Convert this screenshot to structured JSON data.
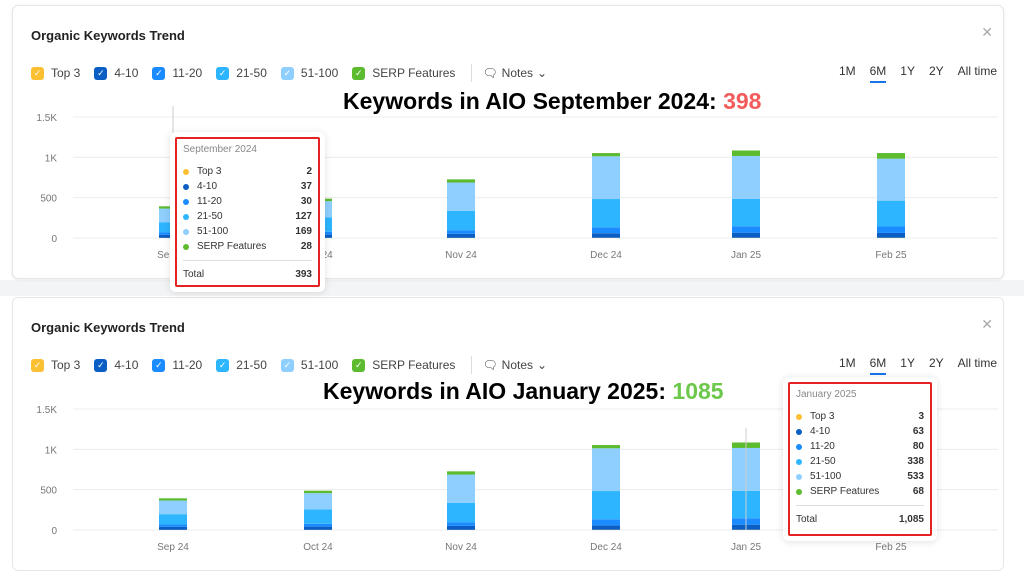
{
  "panel_title": "Organic Keywords Trend",
  "legend": [
    {
      "label": "Top 3",
      "color": "#fbbf32"
    },
    {
      "label": "4-10",
      "color": "#0b5fc4"
    },
    {
      "label": "11-20",
      "color": "#1a8cff"
    },
    {
      "label": "21-50",
      "color": "#2db5ff"
    },
    {
      "label": "51-100",
      "color": "#8fcfff"
    },
    {
      "label": "SERP Features",
      "color": "#5dbb2f"
    }
  ],
  "notes_label": "Notes",
  "ranges": [
    "1M",
    "6M",
    "1Y",
    "2Y",
    "All time"
  ],
  "active_range": "6M",
  "headline_top": {
    "text": "Keywords in AIO September 2024: ",
    "value": "398",
    "color": "#f25c5c"
  },
  "headline_bottom": {
    "text": "Keywords in AIO January 2025: ",
    "value": "1085",
    "color": "#6cc84a"
  },
  "tooltip_top": {
    "title": "September 2024",
    "rows": [
      {
        "label": "Top 3",
        "value": "2"
      },
      {
        "label": "4-10",
        "value": "37"
      },
      {
        "label": "11-20",
        "value": "30"
      },
      {
        "label": "21-50",
        "value": "127"
      },
      {
        "label": "51-100",
        "value": "169"
      },
      {
        "label": "SERP Features",
        "value": "28"
      }
    ],
    "total_label": "Total",
    "total": "393"
  },
  "tooltip_bottom": {
    "title": "January 2025",
    "rows": [
      {
        "label": "Top 3",
        "value": "3"
      },
      {
        "label": "4-10",
        "value": "63"
      },
      {
        "label": "11-20",
        "value": "80"
      },
      {
        "label": "21-50",
        "value": "338"
      },
      {
        "label": "51-100",
        "value": "533"
      },
      {
        "label": "SERP Features",
        "value": "68"
      }
    ],
    "total_label": "Total",
    "total": "1,085"
  },
  "chart_data": {
    "type": "bar",
    "stacked": true,
    "categories": [
      "Sep 24",
      "Oct 24",
      "Nov 24",
      "Dec 24",
      "Jan 25",
      "Feb 25"
    ],
    "yticks": [
      "0",
      "500",
      "1K",
      "1.5K"
    ],
    "ylim": [
      0,
      1500
    ],
    "grid": true,
    "series": [
      {
        "name": "Top 3",
        "values": [
          2,
          2,
          2,
          3,
          3,
          3
        ]
      },
      {
        "name": "4-10",
        "values": [
          37,
          40,
          50,
          55,
          63,
          60
        ]
      },
      {
        "name": "11-20",
        "values": [
          30,
          35,
          45,
          75,
          80,
          80
        ]
      },
      {
        "name": "21-50",
        "values": [
          127,
          180,
          240,
          350,
          338,
          320
        ]
      },
      {
        "name": "51-100",
        "values": [
          169,
          200,
          350,
          530,
          533,
          520
        ]
      },
      {
        "name": "SERP Features",
        "values": [
          28,
          30,
          40,
          40,
          68,
          70
        ]
      }
    ]
  }
}
